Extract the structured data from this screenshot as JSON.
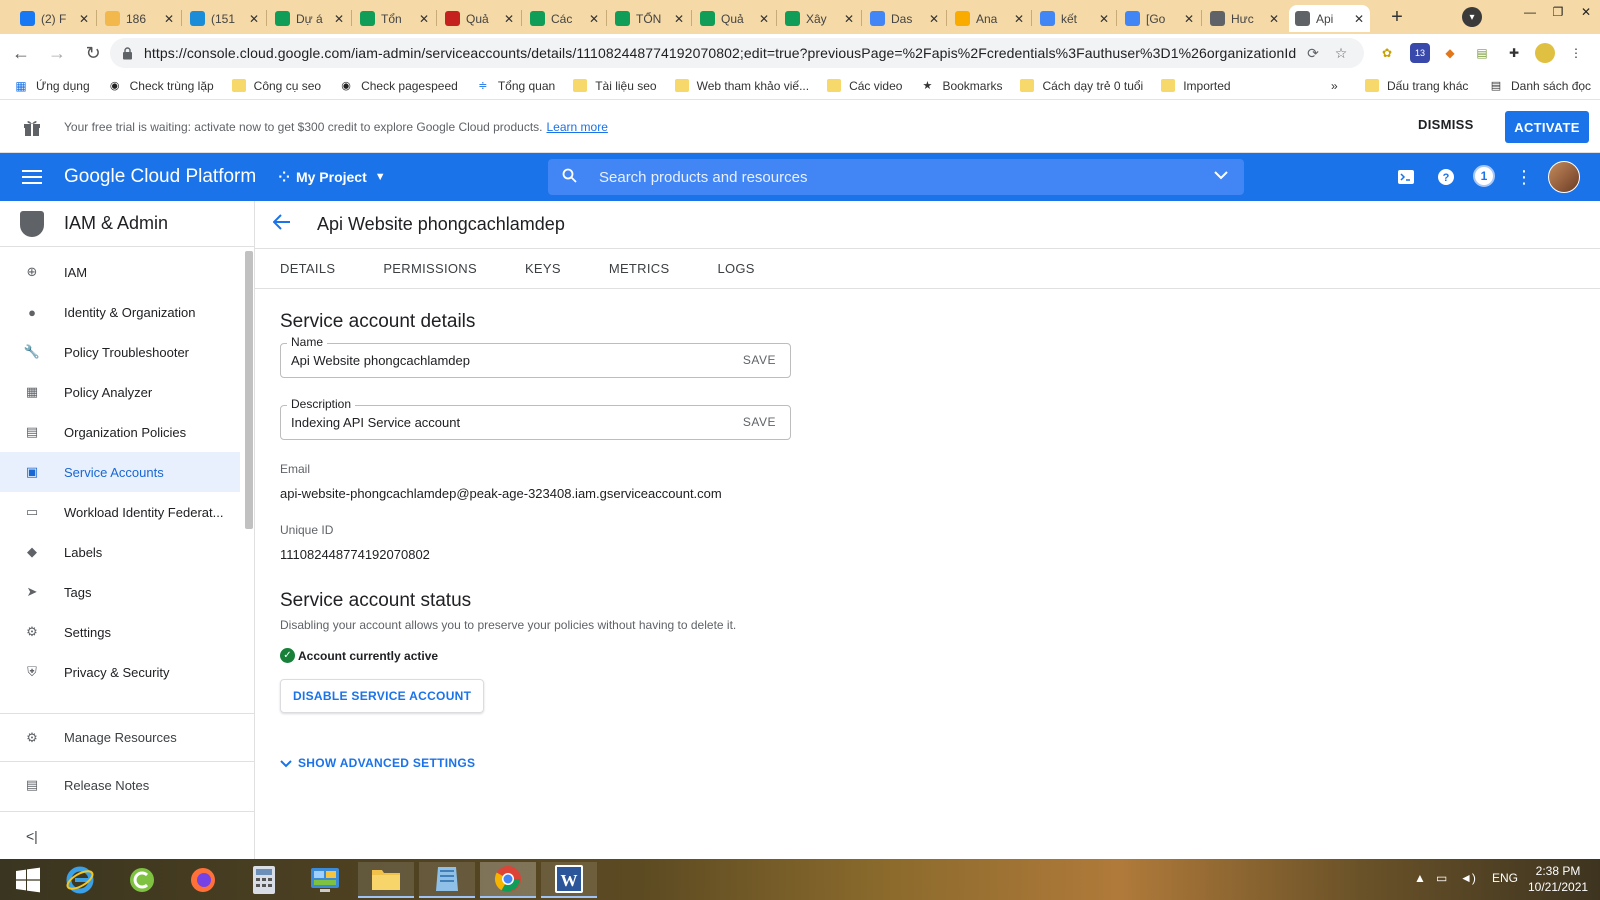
{
  "browser": {
    "tabs": [
      {
        "label": "(2) F",
        "icon": "facebook-icon",
        "color": "#1877f2"
      },
      {
        "label": "186",
        "icon": "smiley-icon",
        "color": "#f2b84b"
      },
      {
        "label": "(151",
        "icon": "skype-icon",
        "color": "#1a8cd8"
      },
      {
        "label": "Dự á",
        "icon": "sheets-icon",
        "color": "#0f9d58"
      },
      {
        "label": "Tổn",
        "icon": "sheets-icon",
        "color": "#0f9d58"
      },
      {
        "label": "Quả",
        "icon": "slides-icon",
        "color": "#c5221f"
      },
      {
        "label": "Các",
        "icon": "sheets-icon",
        "color": "#0f9d58"
      },
      {
        "label": "TỔN",
        "icon": "sheets-icon",
        "color": "#0f9d58"
      },
      {
        "label": "Quả",
        "icon": "sheets-icon",
        "color": "#0f9d58"
      },
      {
        "label": "Xây",
        "icon": "sheets-icon",
        "color": "#0f9d58"
      },
      {
        "label": "Das",
        "icon": "datastudio-icon",
        "color": "#4285f4"
      },
      {
        "label": "Ana",
        "icon": "analytics-icon",
        "color": "#f9ab00"
      },
      {
        "label": "kết",
        "icon": "google-icon",
        "color": "#4285f4"
      },
      {
        "label": "[Go",
        "icon": "drive-icon",
        "color": "#4285f4"
      },
      {
        "label": "Hưc",
        "icon": "globe-icon",
        "color": "#5f6368"
      },
      {
        "label": "Api",
        "icon": "gcp-icon",
        "color": "#5f6368",
        "active": true
      }
    ],
    "url": "https://console.cloud.google.com/iam-admin/serviceaccounts/details/111082448774192070802;edit=true?previousPage=%2Fapis%2Fcredentials%3Fauthuser%3D1%26organizationId%...",
    "bookmarks": {
      "apps": "Ứng dụng",
      "items": [
        "Check trùng lặp",
        "Công cụ seo",
        "Check pagespeed",
        "Tổng quan",
        "Tài liệu seo",
        "Web tham khảo viế...",
        "Các video",
        "Bookmarks",
        "Cách dạy trẻ 0 tuổi",
        "Imported"
      ],
      "other": "Dấu trang khác",
      "reading_list": "Danh sách đọc",
      "overflow": "»"
    },
    "extension_badge": "13"
  },
  "trial": {
    "text": "Your free trial is waiting: activate now to get $300 credit to explore Google Cloud products.",
    "link": "Learn more",
    "dismiss": "DISMISS",
    "activate": "ACTIVATE"
  },
  "header": {
    "logo": "Google Cloud Platform",
    "project": "My Project",
    "search_placeholder": "Search products and resources",
    "notifications": "1"
  },
  "sidebar": {
    "title": "IAM & Admin",
    "items": [
      {
        "label": "IAM",
        "icon": "person-add-icon"
      },
      {
        "label": "Identity & Organization",
        "icon": "account-circle-icon"
      },
      {
        "label": "Policy Troubleshooter",
        "icon": "wrench-icon"
      },
      {
        "label": "Policy Analyzer",
        "icon": "policy-analyzer-icon"
      },
      {
        "label": "Organization Policies",
        "icon": "document-icon"
      },
      {
        "label": "Service Accounts",
        "icon": "service-account-icon",
        "selected": true
      },
      {
        "label": "Workload Identity Federat...",
        "icon": "workload-identity-icon"
      },
      {
        "label": "Labels",
        "icon": "label-icon"
      },
      {
        "label": "Tags",
        "icon": "tag-icon"
      },
      {
        "label": "Settings",
        "icon": "gear-icon"
      },
      {
        "label": "Privacy & Security",
        "icon": "shield-icon"
      }
    ],
    "manage_resources": "Manage Resources",
    "release_notes": "Release Notes",
    "collapse": "<|"
  },
  "page": {
    "title": "Api Website phongcachlamdep",
    "tabs": [
      "DETAILS",
      "PERMISSIONS",
      "KEYS",
      "METRICS",
      "LOGS"
    ],
    "details_heading": "Service account details",
    "name_label": "Name",
    "name_value": "Api Website phongcachlamdep",
    "description_label": "Description",
    "description_value": "Indexing API Service account",
    "save_label": "SAVE",
    "email_label": "Email",
    "email_value": "api-website-phongcachlamdep@peak-age-323408.iam.gserviceaccount.com",
    "unique_id_label": "Unique ID",
    "unique_id_value": "111082448774192070802",
    "status_heading": "Service account status",
    "status_desc": "Disabling your account allows you to preserve your policies without having to delete it.",
    "status_active": "Account currently active",
    "disable_button": "DISABLE SERVICE ACCOUNT",
    "advanced": "SHOW ADVANCED SETTINGS"
  },
  "taskbar": {
    "language": "ENG",
    "time": "2:38 PM",
    "date": "10/21/2021"
  },
  "colors": {
    "primary": "#1a73e8",
    "active_green": "#188038",
    "tabstrip": "#f5d9a6"
  }
}
